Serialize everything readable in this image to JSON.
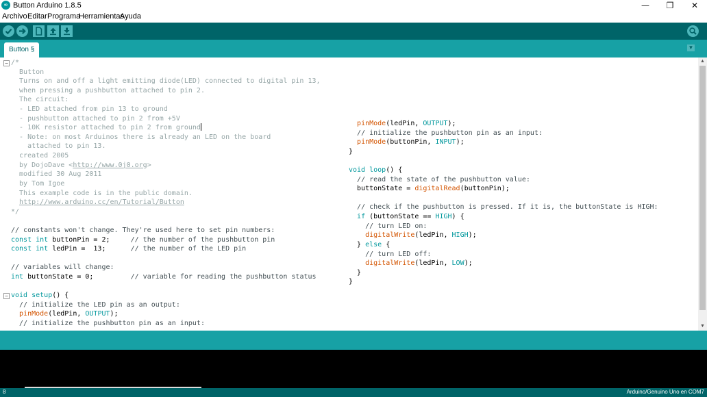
{
  "window": {
    "title": "Button Arduino 1.8.5",
    "app_icon_text": "∞",
    "minimize_glyph": "—",
    "maximize_glyph": "❐",
    "close_glyph": "✕"
  },
  "menu": [
    "Archivo",
    "Editar",
    "Programa",
    "Herramientas",
    "Ayuda"
  ],
  "toolbar": {
    "buttons": [
      "verify-icon",
      "upload-icon",
      "new-icon",
      "open-icon",
      "save-icon"
    ],
    "serial_monitor": "serial-monitor-icon"
  },
  "tab": {
    "label": "Button §",
    "menu_glyph": "▼"
  },
  "fold_markers": {
    "open_comment": "−",
    "setup": "−"
  },
  "code_left": [
    [
      {
        "c": "tk-comment",
        "t": "/*"
      }
    ],
    [
      {
        "c": "tk-comment",
        "t": "  Button"
      }
    ],
    [
      {
        "c": "tk-comment",
        "t": "  Turns on and off a light emitting diode(LED) connected to digital pin 13,"
      }
    ],
    [
      {
        "c": "tk-comment",
        "t": "  when pressing a pushbutton attached to pin 2."
      }
    ],
    [
      {
        "c": "tk-comment",
        "t": "  The circuit:"
      }
    ],
    [
      {
        "c": "tk-comment",
        "t": "  - LED attached from pin 13 to ground"
      }
    ],
    [
      {
        "c": "tk-comment",
        "t": "  - pushbutton attached to pin 2 from +5V"
      }
    ],
    [
      {
        "c": "tk-comment",
        "t": "  - 10K resistor attached to pin 2 from ground"
      },
      {
        "c": "caret",
        "t": ""
      }
    ],
    [
      {
        "c": "tk-comment",
        "t": "  - Note: on most Arduinos there is already an LED on the board"
      }
    ],
    [
      {
        "c": "tk-comment",
        "t": "    attached to pin 13."
      }
    ],
    [
      {
        "c": "tk-comment",
        "t": "  created 2005"
      }
    ],
    [
      {
        "c": "tk-comment",
        "t": "  by DojoDave <"
      },
      {
        "c": "tk-link",
        "t": "http://www.0j0.org"
      },
      {
        "c": "tk-comment",
        "t": ">"
      }
    ],
    [
      {
        "c": "tk-comment",
        "t": "  modified 30 Aug 2011"
      }
    ],
    [
      {
        "c": "tk-comment",
        "t": "  by Tom Igoe"
      }
    ],
    [
      {
        "c": "tk-comment",
        "t": "  This example code is in the public domain."
      }
    ],
    [
      {
        "c": "tk-comment",
        "t": "  "
      },
      {
        "c": "tk-link",
        "t": "http://www.arduino.cc/en/Tutorial/Button"
      }
    ],
    [
      {
        "c": "tk-comment",
        "t": "*/"
      }
    ],
    [
      {
        "c": "tk-plain",
        "t": ""
      }
    ],
    [
      {
        "c": "tk-line-comment",
        "t": "// constants won't change. They're used here to set pin numbers:"
      }
    ],
    [
      {
        "c": "tk-keyword",
        "t": "const int"
      },
      {
        "c": "tk-plain",
        "t": " buttonPin = 2;     "
      },
      {
        "c": "tk-line-comment",
        "t": "// the number of the pushbutton pin"
      }
    ],
    [
      {
        "c": "tk-keyword",
        "t": "const int"
      },
      {
        "c": "tk-plain",
        "t": " ledPin =  13;      "
      },
      {
        "c": "tk-line-comment",
        "t": "// the number of the LED pin"
      }
    ],
    [
      {
        "c": "tk-plain",
        "t": ""
      }
    ],
    [
      {
        "c": "tk-line-comment",
        "t": "// variables will change:"
      }
    ],
    [
      {
        "c": "tk-keyword",
        "t": "int"
      },
      {
        "c": "tk-plain",
        "t": " buttonState = 0;         "
      },
      {
        "c": "tk-line-comment",
        "t": "// variable for reading the pushbutton status"
      }
    ],
    [
      {
        "c": "tk-plain",
        "t": ""
      }
    ],
    [
      {
        "c": "tk-keyword",
        "t": "void"
      },
      {
        "c": "tk-plain",
        "t": " "
      },
      {
        "c": "tk-keyword",
        "t": "setup"
      },
      {
        "c": "tk-plain",
        "t": "() {"
      }
    ],
    [
      {
        "c": "tk-plain",
        "t": "  "
      },
      {
        "c": "tk-line-comment",
        "t": "// initialize the LED pin as an output:"
      }
    ],
    [
      {
        "c": "tk-plain",
        "t": "  "
      },
      {
        "c": "tk-func",
        "t": "pinMode"
      },
      {
        "c": "tk-plain",
        "t": "(ledPin, "
      },
      {
        "c": "tk-keyword",
        "t": "OUTPUT"
      },
      {
        "c": "tk-plain",
        "t": ");"
      }
    ],
    [
      {
        "c": "tk-plain",
        "t": "  "
      },
      {
        "c": "tk-line-comment",
        "t": "// initialize the pushbutton pin as an input:"
      }
    ]
  ],
  "code_right": [
    [
      {
        "c": "tk-plain",
        "t": "  "
      },
      {
        "c": "tk-func",
        "t": "pinMode"
      },
      {
        "c": "tk-plain",
        "t": "(ledPin, "
      },
      {
        "c": "tk-keyword",
        "t": "OUTPUT"
      },
      {
        "c": "tk-plain",
        "t": ");"
      }
    ],
    [
      {
        "c": "tk-plain",
        "t": "  "
      },
      {
        "c": "tk-line-comment",
        "t": "// initialize the pushbutton pin as an input:"
      }
    ],
    [
      {
        "c": "tk-plain",
        "t": "  "
      },
      {
        "c": "tk-func",
        "t": "pinMode"
      },
      {
        "c": "tk-plain",
        "t": "(buttonPin, "
      },
      {
        "c": "tk-keyword",
        "t": "INPUT"
      },
      {
        "c": "tk-plain",
        "t": ");"
      }
    ],
    [
      {
        "c": "tk-plain",
        "t": "}"
      }
    ],
    [
      {
        "c": "tk-plain",
        "t": ""
      }
    ],
    [
      {
        "c": "tk-keyword",
        "t": "void"
      },
      {
        "c": "tk-plain",
        "t": " "
      },
      {
        "c": "tk-keyword",
        "t": "loop"
      },
      {
        "c": "tk-plain",
        "t": "() {"
      }
    ],
    [
      {
        "c": "tk-plain",
        "t": "  "
      },
      {
        "c": "tk-line-comment",
        "t": "// read the state of the pushbutton value:"
      }
    ],
    [
      {
        "c": "tk-plain",
        "t": "  buttonState = "
      },
      {
        "c": "tk-func",
        "t": "digitalRead"
      },
      {
        "c": "tk-plain",
        "t": "(buttonPin);"
      }
    ],
    [
      {
        "c": "tk-plain",
        "t": ""
      }
    ],
    [
      {
        "c": "tk-plain",
        "t": "  "
      },
      {
        "c": "tk-line-comment",
        "t": "// check if the pushbutton is pressed. If it is, the buttonState is HIGH:"
      }
    ],
    [
      {
        "c": "tk-plain",
        "t": "  "
      },
      {
        "c": "tk-keyword",
        "t": "if"
      },
      {
        "c": "tk-plain",
        "t": " (buttonState == "
      },
      {
        "c": "tk-keyword",
        "t": "HIGH"
      },
      {
        "c": "tk-plain",
        "t": ") {"
      }
    ],
    [
      {
        "c": "tk-plain",
        "t": "    "
      },
      {
        "c": "tk-line-comment",
        "t": "// turn LED on:"
      }
    ],
    [
      {
        "c": "tk-plain",
        "t": "    "
      },
      {
        "c": "tk-func",
        "t": "digitalWrite"
      },
      {
        "c": "tk-plain",
        "t": "(ledPin, "
      },
      {
        "c": "tk-keyword",
        "t": "HIGH"
      },
      {
        "c": "tk-plain",
        "t": ");"
      }
    ],
    [
      {
        "c": "tk-plain",
        "t": "  } "
      },
      {
        "c": "tk-keyword",
        "t": "else"
      },
      {
        "c": "tk-plain",
        "t": " {"
      }
    ],
    [
      {
        "c": "tk-plain",
        "t": "    "
      },
      {
        "c": "tk-line-comment",
        "t": "// turn LED off:"
      }
    ],
    [
      {
        "c": "tk-plain",
        "t": "    "
      },
      {
        "c": "tk-func",
        "t": "digitalWrite"
      },
      {
        "c": "tk-plain",
        "t": "(ledPin, "
      },
      {
        "c": "tk-keyword",
        "t": "LOW"
      },
      {
        "c": "tk-plain",
        "t": ");"
      }
    ],
    [
      {
        "c": "tk-plain",
        "t": "  }"
      }
    ],
    [
      {
        "c": "tk-plain",
        "t": "}"
      }
    ]
  ],
  "scrollbar": {
    "up_glyph": "▲",
    "down_glyph": "▼"
  },
  "footer": {
    "line_number": "8",
    "board": "Arduino/Genuino Uno en COM7"
  },
  "colors": {
    "toolbar": "#006468",
    "tabbar": "#17a1a5",
    "button": "#4db7bb",
    "comment": "#95a5a6",
    "keyword": "#00979c",
    "function": "#d35400"
  }
}
